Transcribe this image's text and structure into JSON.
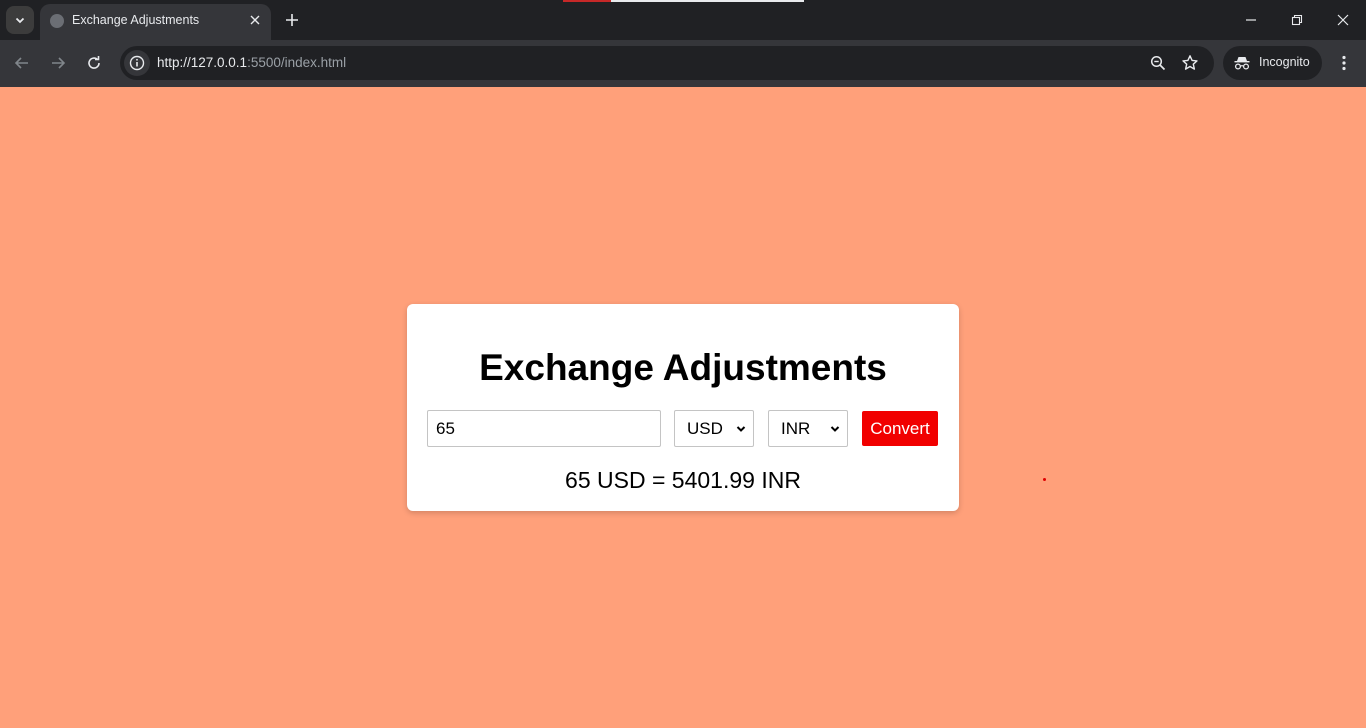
{
  "browser": {
    "tab_title": "Exchange Adjustments",
    "url_host": "http://127.0.0.1",
    "url_rest": ":5500/index.html",
    "incognito_label": "Incognito"
  },
  "page": {
    "background": "#ffa07a",
    "title": "Exchange Adjustments",
    "amount_value": "65",
    "from_currency": "USD",
    "to_currency": "INR",
    "convert_label": "Convert",
    "convert_color": "#f10000",
    "result": "65 USD = 5401.99 INR"
  },
  "icons": {
    "tab_search": "chevron-down-icon",
    "favicon": "globe-icon",
    "tab_close": "close-icon",
    "new_tab": "plus-icon",
    "back": "arrow-left-icon",
    "forward": "arrow-right-icon",
    "reload": "reload-icon",
    "site_info": "info-icon",
    "zoom": "zoom-out-icon",
    "bookmark": "star-icon",
    "incognito": "incognito-icon",
    "menu": "kebab-menu-icon"
  }
}
